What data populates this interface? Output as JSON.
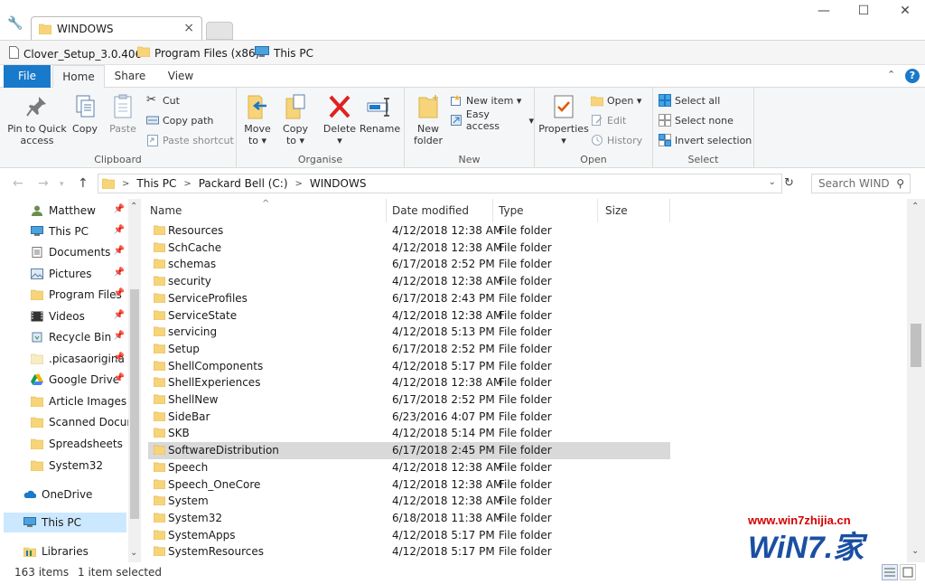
{
  "window": {
    "tab_title": "WINDOWS"
  },
  "bookmarks": [
    {
      "label": "Clover_Setup_3.0.406"
    },
    {
      "label": "Program Files (x86)"
    },
    {
      "label": "This PC"
    }
  ],
  "ribbon_tabs": {
    "file": "File",
    "home": "Home",
    "share": "Share",
    "view": "View"
  },
  "clipboard": {
    "pin_line1": "Pin to Quick",
    "pin_line2": "access",
    "copy": "Copy",
    "paste": "Paste",
    "cut": "Cut",
    "copy_path": "Copy path",
    "paste_shortcut": "Paste shortcut",
    "label": "Clipboard"
  },
  "organise": {
    "move_line1": "Move",
    "move_line2": "to",
    "copy_line1": "Copy",
    "copy_line2": "to",
    "delete": "Delete",
    "rename": "Rename",
    "label": "Organise"
  },
  "new_group": {
    "folder_line1": "New",
    "folder_line2": "folder",
    "new_item": "New item",
    "easy_access": "Easy access",
    "label": "New"
  },
  "open_group": {
    "properties": "Properties",
    "open": "Open",
    "edit": "Edit",
    "history": "History",
    "label": "Open"
  },
  "select_group": {
    "select_all": "Select all",
    "select_none": "Select none",
    "invert": "Invert selection",
    "label": "Select"
  },
  "address": {
    "crumbs": [
      "This PC",
      "Packard Bell (C:)",
      "WINDOWS"
    ],
    "search_placeholder": "Search WIND"
  },
  "nav": {
    "items": [
      {
        "label": "Matthew",
        "pinned": true
      },
      {
        "label": "This PC",
        "pinned": true
      },
      {
        "label": "Documents",
        "pinned": true
      },
      {
        "label": "Pictures",
        "pinned": true
      },
      {
        "label": "Program Files",
        "pinned": true
      },
      {
        "label": "Videos",
        "pinned": true
      },
      {
        "label": "Recycle Bin",
        "pinned": true
      },
      {
        "label": ".picasaorigina",
        "pinned": true
      },
      {
        "label": "Google Drive",
        "pinned": true
      },
      {
        "label": "Article Images",
        "pinned": false
      },
      {
        "label": "Scanned Docum",
        "pinned": false
      },
      {
        "label": "Spreadsheets",
        "pinned": false
      },
      {
        "label": "System32",
        "pinned": false
      },
      {
        "label": "OneDrive",
        "pinned": false
      },
      {
        "label": "This PC",
        "pinned": false
      },
      {
        "label": "Libraries",
        "pinned": false
      }
    ]
  },
  "columns": {
    "name": "Name",
    "date": "Date modified",
    "type": "Type",
    "size": "Size"
  },
  "files": [
    {
      "name": "Resources",
      "date": "4/12/2018 12:38 AM",
      "type": "File folder"
    },
    {
      "name": "SchCache",
      "date": "4/12/2018 12:38 AM",
      "type": "File folder"
    },
    {
      "name": "schemas",
      "date": "6/17/2018 2:52 PM",
      "type": "File folder"
    },
    {
      "name": "security",
      "date": "4/12/2018 12:38 AM",
      "type": "File folder"
    },
    {
      "name": "ServiceProfiles",
      "date": "6/17/2018 2:43 PM",
      "type": "File folder"
    },
    {
      "name": "ServiceState",
      "date": "4/12/2018 12:38 AM",
      "type": "File folder"
    },
    {
      "name": "servicing",
      "date": "4/12/2018 5:13 PM",
      "type": "File folder"
    },
    {
      "name": "Setup",
      "date": "6/17/2018 2:52 PM",
      "type": "File folder"
    },
    {
      "name": "ShellComponents",
      "date": "4/12/2018 5:17 PM",
      "type": "File folder"
    },
    {
      "name": "ShellExperiences",
      "date": "4/12/2018 12:38 AM",
      "type": "File folder"
    },
    {
      "name": "ShellNew",
      "date": "6/17/2018 2:52 PM",
      "type": "File folder"
    },
    {
      "name": "SideBar",
      "date": "6/23/2016 4:07 PM",
      "type": "File folder"
    },
    {
      "name": "SKB",
      "date": "4/12/2018 5:14 PM",
      "type": "File folder"
    },
    {
      "name": "SoftwareDistribution",
      "date": "6/17/2018 2:45 PM",
      "type": "File folder"
    },
    {
      "name": "Speech",
      "date": "4/12/2018 12:38 AM",
      "type": "File folder"
    },
    {
      "name": "Speech_OneCore",
      "date": "4/12/2018 12:38 AM",
      "type": "File folder"
    },
    {
      "name": "System",
      "date": "4/12/2018 12:38 AM",
      "type": "File folder"
    },
    {
      "name": "System32",
      "date": "6/18/2018 11:38 AM",
      "type": "File folder"
    },
    {
      "name": "SystemApps",
      "date": "4/12/2018 5:17 PM",
      "type": "File folder"
    },
    {
      "name": "SystemResources",
      "date": "4/12/2018 5:17 PM",
      "type": "File folder"
    }
  ],
  "status": {
    "item_count": "163 items",
    "selection": "1 item selected"
  },
  "watermark": {
    "url": "www.win7zhijia.cn",
    "logo_text": "WiN7.家"
  },
  "colors": {
    "accent": "#1979ca",
    "folder": "#f7d479",
    "selected_row": "#d9d9d9",
    "nav_selected": "#cce8ff",
    "watermark": "#d40000"
  }
}
